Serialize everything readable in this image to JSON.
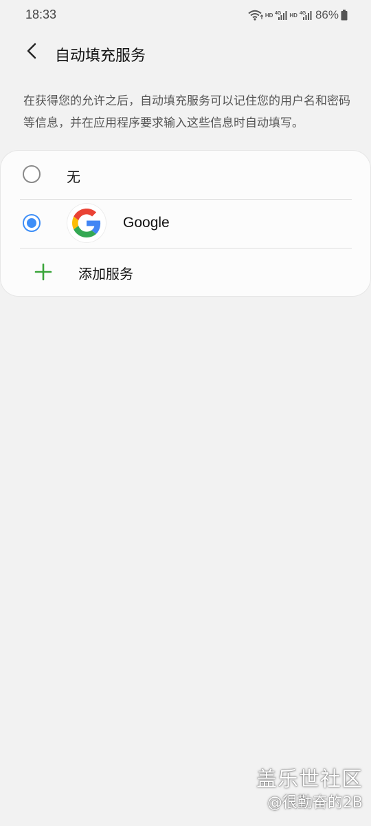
{
  "status_bar": {
    "time": "18:33",
    "hd1": "HD",
    "hd2": "HD",
    "battery": "86%",
    "icons": [
      "wifi-icon",
      "signal-4g-icon",
      "signal-4g-icon",
      "battery-icon"
    ]
  },
  "header": {
    "title": "自动填充服务",
    "back_icon": "back-arrow-icon"
  },
  "description": {
    "text": "在获得您的允许之后，自动填充服务可以记住您的用户名和密码等信息，并在应用程序要求输入这些信息时自动填写。"
  },
  "options": [
    {
      "label": "无",
      "selected": false
    },
    {
      "label": "Google",
      "selected": true,
      "icon": "google-logo-icon"
    },
    {
      "label": "添加服务",
      "icon": "plus-icon"
    }
  ],
  "colors": {
    "accent": "#3e8ef7",
    "add_green": "#3aa53a",
    "background": "#f2f2f2",
    "card": "#fcfcfc"
  },
  "watermark": {
    "line1": "盖乐世社区",
    "line2": "@很勤奋的2B"
  }
}
